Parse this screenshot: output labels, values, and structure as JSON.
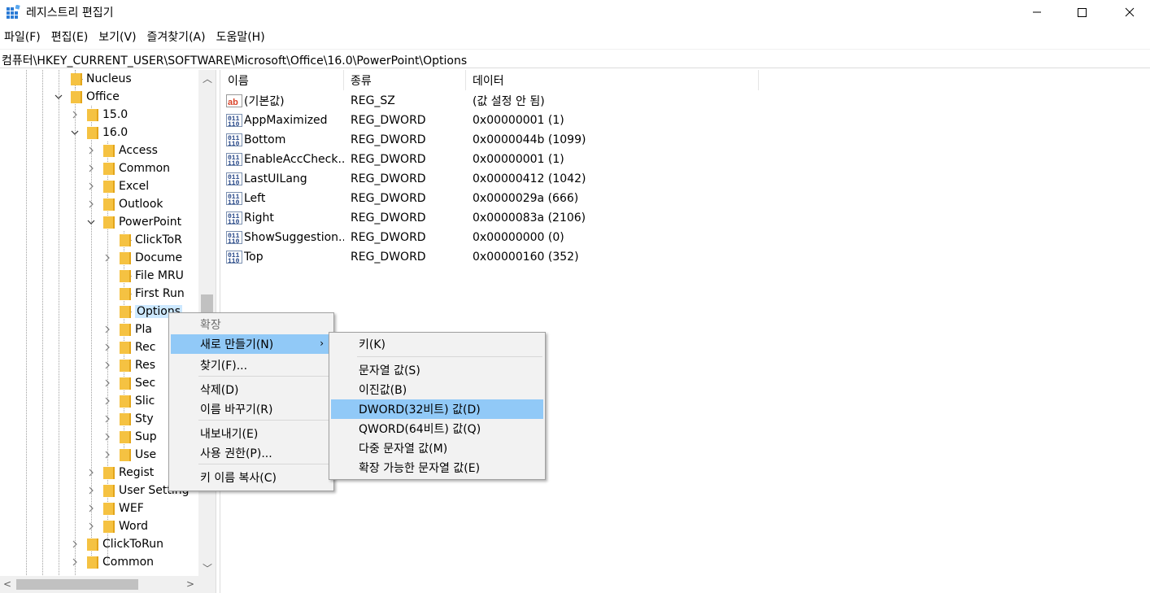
{
  "window": {
    "title": "레지스트리 편집기",
    "icon": "registry-editor-icon"
  },
  "menubar": {
    "items": [
      "파일(F)",
      "편집(E)",
      "보기(V)",
      "즐겨찾기(A)",
      "도움말(H)"
    ]
  },
  "address": {
    "path": "컴퓨터\\HKEY_CURRENT_USER\\SOFTWARE\\Microsoft\\Office\\16.0\\PowerPoint\\Options"
  },
  "tree": {
    "items": [
      {
        "label": "Nucleus",
        "expander": "none"
      },
      {
        "label": "Office",
        "expander": "expanded"
      },
      {
        "label": "15.0",
        "expander": "collapsed"
      },
      {
        "label": "16.0",
        "expander": "expanded"
      },
      {
        "label": "Access",
        "expander": "collapsed"
      },
      {
        "label": "Common",
        "expander": "collapsed"
      },
      {
        "label": "Excel",
        "expander": "collapsed"
      },
      {
        "label": "Outlook",
        "expander": "collapsed"
      },
      {
        "label": "PowerPoint",
        "expander": "expanded"
      },
      {
        "label": "ClickToR",
        "expander": "none"
      },
      {
        "label": "Docume",
        "expander": "collapsed"
      },
      {
        "label": "File MRU",
        "expander": "none"
      },
      {
        "label": "First Run",
        "expander": "none"
      },
      {
        "label": "Options",
        "expander": "none",
        "selected": true
      },
      {
        "label": "Pla",
        "expander": "collapsed"
      },
      {
        "label": "Rec",
        "expander": "collapsed"
      },
      {
        "label": "Res",
        "expander": "collapsed"
      },
      {
        "label": "Sec",
        "expander": "collapsed"
      },
      {
        "label": "Slic",
        "expander": "collapsed"
      },
      {
        "label": "Sty",
        "expander": "collapsed"
      },
      {
        "label": "Sup",
        "expander": "collapsed"
      },
      {
        "label": "Use",
        "expander": "collapsed"
      },
      {
        "label": "Regist",
        "expander": "collapsed"
      },
      {
        "label": "User Setting",
        "expander": "collapsed"
      },
      {
        "label": "WEF",
        "expander": "collapsed"
      },
      {
        "label": "Word",
        "expander": "collapsed"
      },
      {
        "label": "ClickToRun",
        "expander": "collapsed"
      },
      {
        "label": "Common",
        "expander": "collapsed"
      }
    ]
  },
  "list": {
    "headers": [
      "이름",
      "종류",
      "데이터"
    ],
    "rows": [
      {
        "icon": "string-value-icon",
        "name": "(기본값)",
        "type": "REG_SZ",
        "data": "(값 설정 안 됨)"
      },
      {
        "icon": "binary-value-icon",
        "name": "AppMaximized",
        "type": "REG_DWORD",
        "data": "0x00000001 (1)"
      },
      {
        "icon": "binary-value-icon",
        "name": "Bottom",
        "type": "REG_DWORD",
        "data": "0x0000044b (1099)"
      },
      {
        "icon": "binary-value-icon",
        "name": "EnableAccCheck...",
        "type": "REG_DWORD",
        "data": "0x00000001 (1)"
      },
      {
        "icon": "binary-value-icon",
        "name": "LastUILang",
        "type": "REG_DWORD",
        "data": "0x00000412 (1042)"
      },
      {
        "icon": "binary-value-icon",
        "name": "Left",
        "type": "REG_DWORD",
        "data": "0x0000029a (666)"
      },
      {
        "icon": "binary-value-icon",
        "name": "Right",
        "type": "REG_DWORD",
        "data": "0x0000083a (2106)"
      },
      {
        "icon": "binary-value-icon",
        "name": "ShowSuggestion...",
        "type": "REG_DWORD",
        "data": "0x00000000 (0)"
      },
      {
        "icon": "binary-value-icon",
        "name": "Top",
        "type": "REG_DWORD",
        "data": "0x00000160 (352)"
      }
    ]
  },
  "context_menu": {
    "items": [
      {
        "label": "확장",
        "disabled": true
      },
      {
        "label": "새로 만들기(N)",
        "highlight": true,
        "submenu": true
      },
      {
        "label": "찾기(F)..."
      },
      {
        "label": "삭제(D)"
      },
      {
        "label": "이름 바꾸기(R)"
      },
      {
        "label": "내보내기(E)"
      },
      {
        "label": "사용 권한(P)..."
      },
      {
        "label": "키 이름 복사(C)"
      }
    ]
  },
  "submenu": {
    "items": [
      {
        "label": "키(K)"
      },
      {
        "label": "문자열 값(S)"
      },
      {
        "label": "이진값(B)"
      },
      {
        "label": "DWORD(32비트) 값(D)",
        "highlight": true
      },
      {
        "label": "QWORD(64비트) 값(Q)"
      },
      {
        "label": "다중 문자열 값(M)"
      },
      {
        "label": "확장 가능한 문자열 값(E)"
      }
    ]
  },
  "colors": {
    "folder": "#f5c242",
    "selection": "#cce8ff",
    "menu_highlight": "#91c9f7",
    "menu_bg": "#f2f2f2"
  }
}
